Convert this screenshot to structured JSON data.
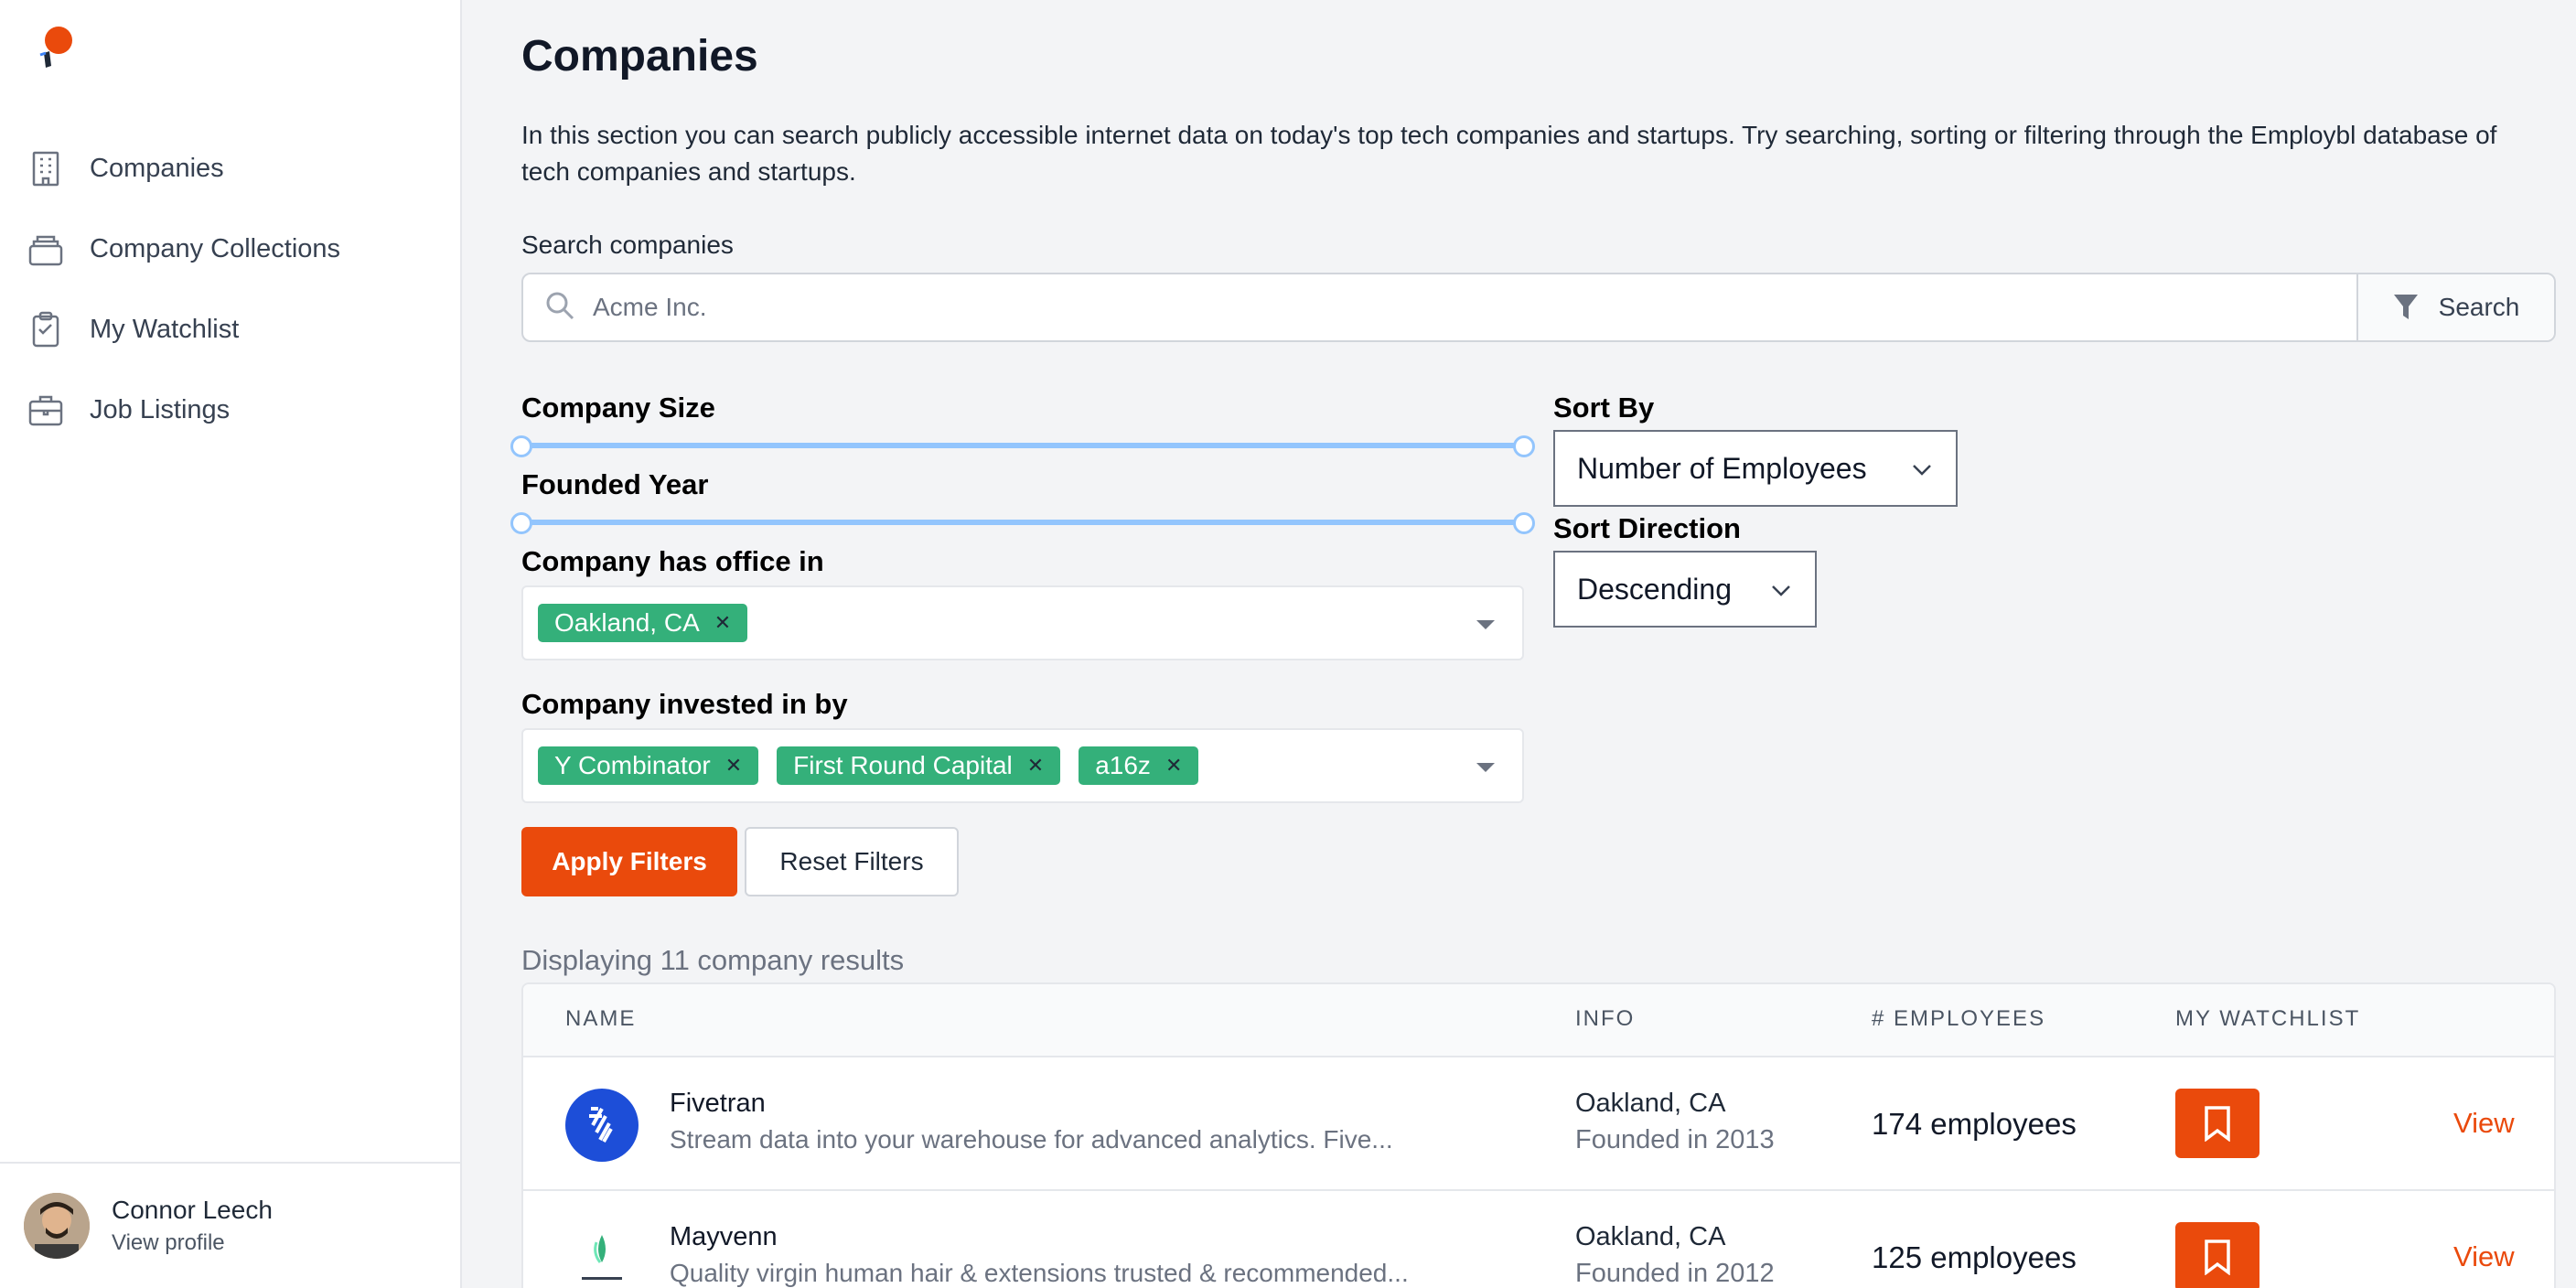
{
  "sidebar": {
    "items": [
      {
        "label": "Companies",
        "icon": "building-icon"
      },
      {
        "label": "Company Collections",
        "icon": "collection-icon"
      },
      {
        "label": "My Watchlist",
        "icon": "clipboard-icon"
      },
      {
        "label": "Job Listings",
        "icon": "briefcase-icon"
      }
    ],
    "profile": {
      "name": "Connor Leech",
      "link": "View profile"
    }
  },
  "main": {
    "title": "Companies",
    "intro": "In this section you can search publicly accessible internet data on today's top tech companies and startups. Try searching, sorting or filtering through the Employbl database of tech companies and startups.",
    "search": {
      "label": "Search companies",
      "placeholder": "Acme Inc.",
      "button": "Search"
    },
    "filters": {
      "company_size_label": "Company Size",
      "founded_year_label": "Founded Year",
      "office_label": "Company has office in",
      "office_chips": [
        "Oakland, CA"
      ],
      "invested_label": "Company invested in by",
      "invested_chips": [
        "Y Combinator",
        "First Round Capital",
        "a16z"
      ],
      "sort_by_label": "Sort By",
      "sort_by_value": "Number of Employees",
      "sort_direction_label": "Sort Direction",
      "sort_direction_value": "Descending",
      "apply": "Apply Filters",
      "reset": "Reset Filters"
    },
    "results_count": "Displaying 11 company results",
    "table": {
      "headers": {
        "name": "NAME",
        "info": "INFO",
        "employees": "# EMPLOYEES",
        "watchlist": "MY WATCHLIST"
      },
      "rows": [
        {
          "name": "Fivetran",
          "description": "Stream data into your warehouse for advanced analytics. Five...",
          "location": "Oakland, CA",
          "founded": "Founded in 2013",
          "employees": "174 employees",
          "action": "View"
        },
        {
          "name": "Mayvenn",
          "description": "Quality virgin human hair & extensions trusted & recommended...",
          "location": "Oakland, CA",
          "founded": "Founded in 2012",
          "employees": "125 employees",
          "action": "View"
        }
      ]
    }
  },
  "colors": {
    "accent": "#ea4a0c",
    "chip": "#34b07a",
    "slider": "#93c5fd"
  }
}
